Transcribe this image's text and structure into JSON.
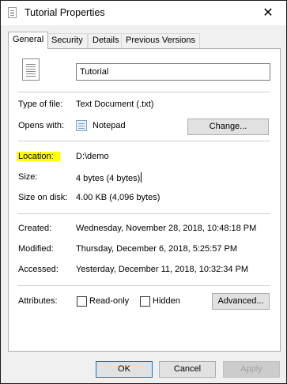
{
  "window": {
    "title": "Tutorial Properties",
    "close_glyph": "✕"
  },
  "tabs": [
    {
      "label": "General",
      "active": true
    },
    {
      "label": "Security",
      "active": false
    },
    {
      "label": "Details",
      "active": false
    },
    {
      "label": "Previous Versions",
      "active": false
    }
  ],
  "general": {
    "file_name": "Tutorial",
    "type_label": "Type of file:",
    "type_value": "Text Document (.txt)",
    "opens_label": "Opens with:",
    "opens_value": "Notepad",
    "change_button": "Change...",
    "location_label": "Location:",
    "location_value": "D:\\demo",
    "size_label": "Size:",
    "size_value": "4 bytes (4 bytes)",
    "size_disk_label": "Size on disk:",
    "size_disk_value": "4.00 KB (4,096 bytes)",
    "created_label": "Created:",
    "created_value": "Wednesday, November 28, 2018, 10:48:18 PM",
    "modified_label": "Modified:",
    "modified_value": "Thursday, December 6, 2018, 5:25:57 PM",
    "accessed_label": "Accessed:",
    "accessed_value": "Yesterday, December 11, 2018, 10:32:34 PM",
    "attributes_label": "Attributes:",
    "readonly_label": "Read-only",
    "readonly_checked": false,
    "hidden_label": "Hidden",
    "hidden_checked": false,
    "advanced_button": "Advanced..."
  },
  "footer": {
    "ok": "OK",
    "cancel": "Cancel",
    "apply": "Apply"
  },
  "colors": {
    "highlight": "#ffff00",
    "accent": "#0078d7"
  },
  "icons": {
    "app": "text-document-icon",
    "file": "text-document-icon",
    "opens_with": "notepad-icon",
    "close": "close-icon"
  }
}
